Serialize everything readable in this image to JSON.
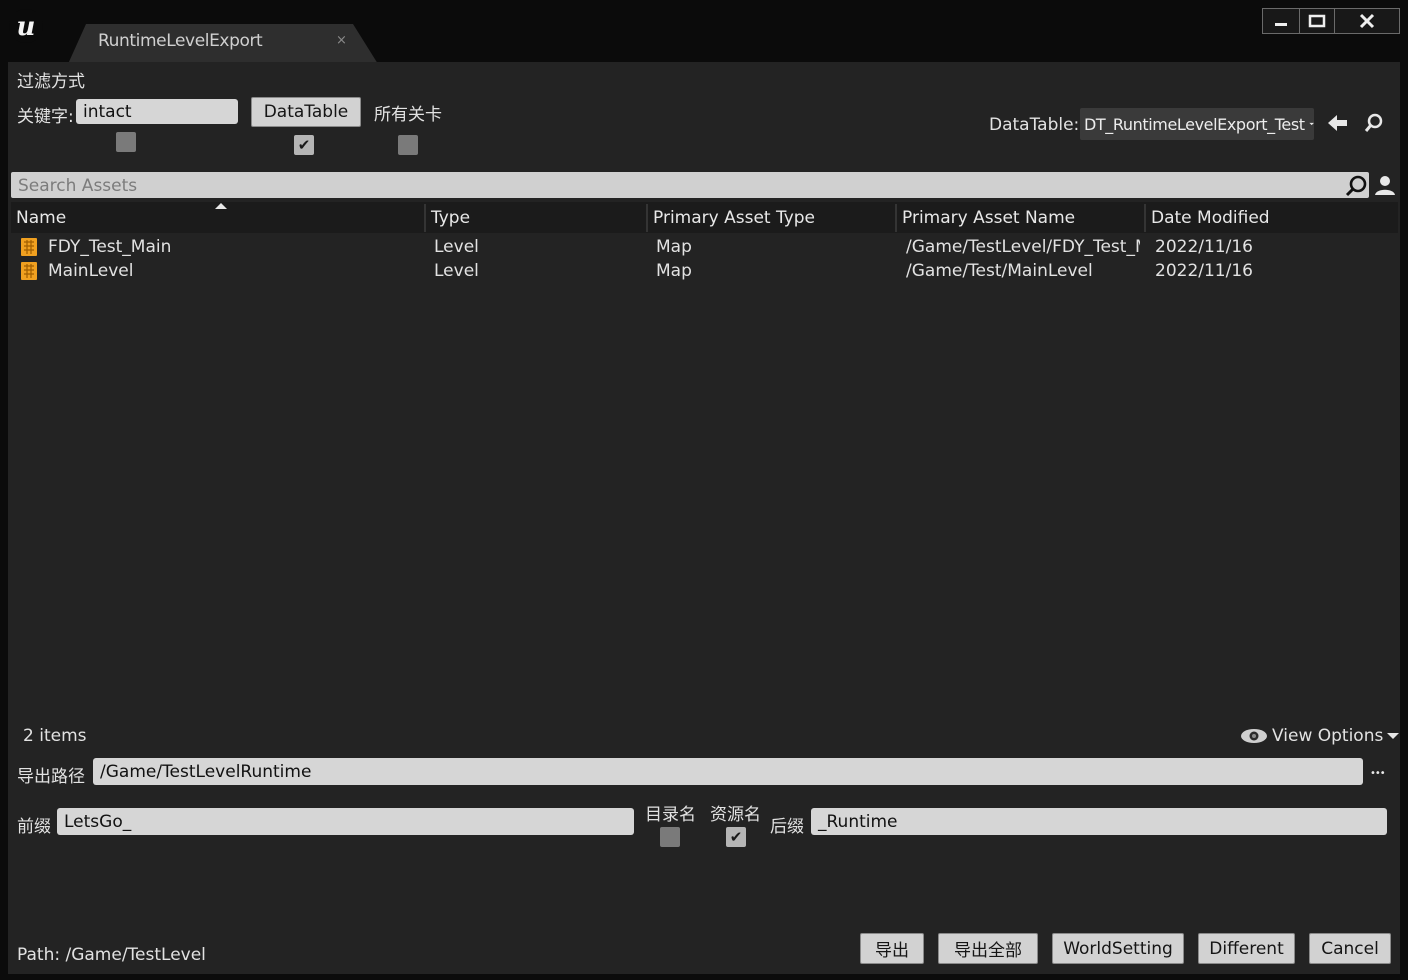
{
  "window": {
    "tab_title": "RuntimeLevelExport",
    "tab_close_glyph": "×",
    "controls": [
      "minimize-icon",
      "maximize-icon",
      "close-icon"
    ]
  },
  "filter": {
    "section_label": "过滤方式",
    "keyword_label": "关键字:",
    "keyword_value": "intact",
    "datatable_button": "DataTable",
    "all_levels_label": "所有关卡",
    "keyword_checked": false,
    "datatable_checked": true,
    "all_levels_checked": false,
    "datatable_field_label": "DataTable:",
    "datatable_selected": "DT_RuntimeLevelExport_Test"
  },
  "search": {
    "placeholder": "Search Assets"
  },
  "table": {
    "columns": [
      "Name",
      "Type",
      "Primary Asset Type",
      "Primary Asset Name",
      "Date Modified"
    ],
    "sort_column": "Name",
    "rows": [
      {
        "name": "FDY_Test_Main",
        "type": "Level",
        "primary_asset_type": "Map",
        "primary_asset_name": "/Game/TestLevel/FDY_Test_Main",
        "date_modified": "2022/11/16"
      },
      {
        "name": "MainLevel",
        "type": "Level",
        "primary_asset_type": "Map",
        "primary_asset_name": "/Game/Test/MainLevel",
        "date_modified": "2022/11/16"
      }
    ],
    "item_count": "2 items",
    "view_options": "View Options"
  },
  "export": {
    "path_label": "导出路径",
    "path_value": "/Game/TestLevelRuntime",
    "browse_glyph": "•••",
    "prefix_label": "前缀",
    "prefix_value": "LetsGo_",
    "dirname_label": "目录名",
    "dirname_checked": false,
    "assetname_label": "资源名",
    "assetname_checked": true,
    "suffix_label": "后缀",
    "suffix_value": "_Runtime"
  },
  "footer": {
    "path_text": "Path:  /Game/TestLevel",
    "buttons": [
      "导出",
      "导出全部",
      "WorldSetting",
      "Different",
      "Cancel"
    ]
  },
  "colors": {
    "background": "#232323",
    "titlebar": "#0b0b0b",
    "level_icon": "#f0a020"
  }
}
